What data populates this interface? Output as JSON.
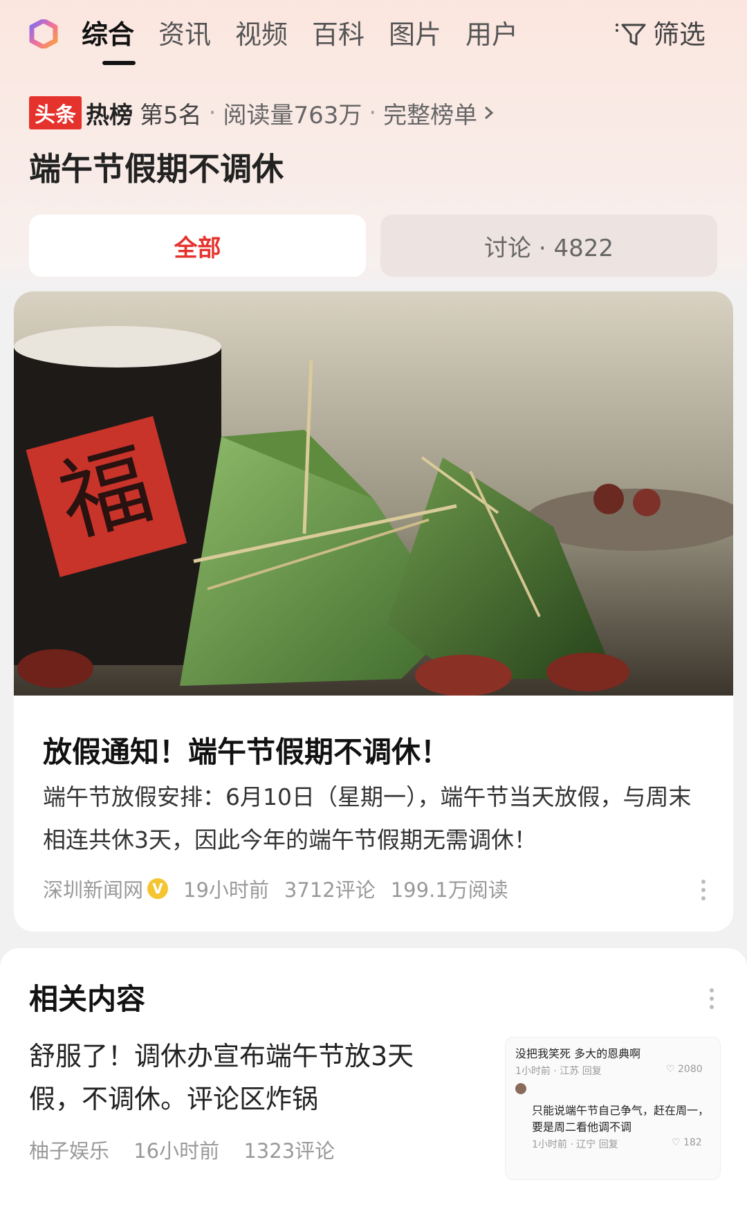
{
  "tabs": [
    {
      "label": "综合",
      "active": true
    },
    {
      "label": "资讯"
    },
    {
      "label": "视频"
    },
    {
      "label": "百科"
    },
    {
      "label": "图片"
    },
    {
      "label": "用户"
    }
  ],
  "filter_label": "筛选",
  "hot": {
    "badge_left": "头条",
    "badge_right": "热榜",
    "rank": "第5名",
    "reads": "阅读量763万",
    "full_list": "完整榜单"
  },
  "page_title": "端午节假期不调休",
  "segments": {
    "all": "全部",
    "discussion": "讨论 · 4822"
  },
  "article": {
    "image_text": "福",
    "title": "放假通知！端午节假期不调休！",
    "desc": "端午节放假安排：6月10日（星期一），端午节当天放假，与周末相连共休3天，因此今年的端午节假期无需调休！",
    "source": "深圳新闻网",
    "verified": "V",
    "time": "19小时前",
    "comments": "3712评论",
    "reads": "199.1万阅读"
  },
  "related": {
    "heading": "相关内容",
    "title": "舒服了！调休办宣布端午节放3天假，不调休。评论区炸锅",
    "source": "柚子娱乐",
    "time": "16小时前",
    "comments": "1323评论",
    "thumb": {
      "c1": "没把我笑死  多大的恩典啊",
      "c1_meta": "1小时前 · 江苏    回复",
      "c1_likes": "2080",
      "c2a": "只能说端午节自己争气，赶在周一，",
      "c2b": "要是周二看他调不调",
      "c2_meta": "1小时前 · 辽宁    回复",
      "c2_likes": "182"
    }
  },
  "colors": {
    "accent": "#e5322d",
    "verified": "#f4c531"
  }
}
